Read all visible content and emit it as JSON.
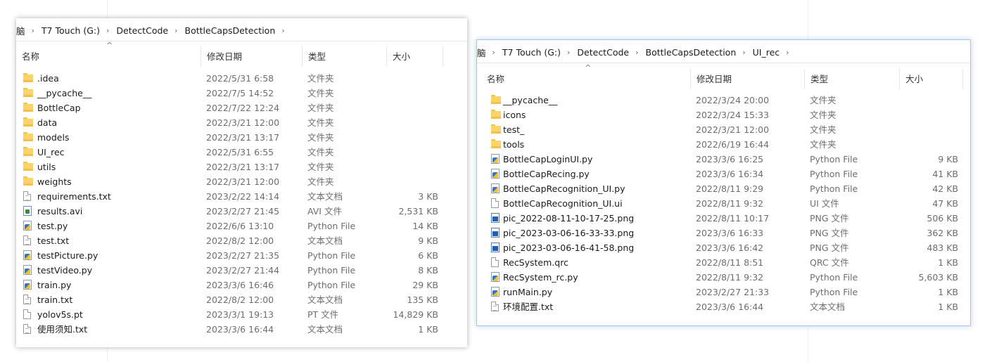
{
  "left": {
    "breadcrumb": [
      "脑",
      "T7 Touch (G:)",
      "DetectCode",
      "BottleCapsDetection"
    ],
    "columns": {
      "name": "名称",
      "date": "修改日期",
      "type": "类型",
      "size": "大小"
    },
    "files": [
      {
        "name": ".idea",
        "date": "2022/5/31 6:58",
        "type": "文件夹",
        "size": "",
        "icon": "folder-icon"
      },
      {
        "name": "__pycache__",
        "date": "2022/7/5 14:52",
        "type": "文件夹",
        "size": "",
        "icon": "folder-icon"
      },
      {
        "name": "BottleCap",
        "date": "2022/7/22 12:24",
        "type": "文件夹",
        "size": "",
        "icon": "folder-icon"
      },
      {
        "name": "data",
        "date": "2022/3/21 12:00",
        "type": "文件夹",
        "size": "",
        "icon": "folder-icon"
      },
      {
        "name": "models",
        "date": "2022/3/21 13:17",
        "type": "文件夹",
        "size": "",
        "icon": "folder-icon"
      },
      {
        "name": "UI_rec",
        "date": "2022/5/31 6:55",
        "type": "文件夹",
        "size": "",
        "icon": "folder-icon"
      },
      {
        "name": "utils",
        "date": "2022/3/21 13:17",
        "type": "文件夹",
        "size": "",
        "icon": "folder-icon"
      },
      {
        "name": "weights",
        "date": "2022/3/21 12:00",
        "type": "文件夹",
        "size": "",
        "icon": "folder-icon"
      },
      {
        "name": "requirements.txt",
        "date": "2023/2/22 14:14",
        "type": "文本文档",
        "size": "3 KB",
        "icon": "text-file-icon"
      },
      {
        "name": "results.avi",
        "date": "2023/2/27 21:45",
        "type": "AVI 文件",
        "size": "2,531 KB",
        "icon": "video-file-icon"
      },
      {
        "name": "test.py",
        "date": "2022/6/6 13:10",
        "type": "Python File",
        "size": "14 KB",
        "icon": "python-file-icon"
      },
      {
        "name": "test.txt",
        "date": "2022/8/2 12:00",
        "type": "文本文档",
        "size": "9 KB",
        "icon": "text-file-icon"
      },
      {
        "name": "testPicture.py",
        "date": "2023/2/27 21:35",
        "type": "Python File",
        "size": "6 KB",
        "icon": "python-file-icon"
      },
      {
        "name": "testVideo.py",
        "date": "2023/2/27 21:44",
        "type": "Python File",
        "size": "8 KB",
        "icon": "python-file-icon"
      },
      {
        "name": "train.py",
        "date": "2023/3/6 16:46",
        "type": "Python File",
        "size": "29 KB",
        "icon": "python-file-icon"
      },
      {
        "name": "train.txt",
        "date": "2022/8/2 12:00",
        "type": "文本文档",
        "size": "135 KB",
        "icon": "text-file-icon"
      },
      {
        "name": "yolov5s.pt",
        "date": "2023/3/1 19:13",
        "type": "PT 文件",
        "size": "14,829 KB",
        "icon": "file-icon"
      },
      {
        "name": "使用须知.txt",
        "date": "2023/3/6 16:44",
        "type": "文本文档",
        "size": "1 KB",
        "icon": "text-file-icon"
      }
    ]
  },
  "right": {
    "breadcrumb": [
      "脑",
      "T7 Touch (G:)",
      "DetectCode",
      "BottleCapsDetection",
      "UI_rec"
    ],
    "columns": {
      "name": "名称",
      "date": "修改日期",
      "type": "类型",
      "size": "大小"
    },
    "files": [
      {
        "name": "__pycache__",
        "date": "2022/3/24 20:00",
        "type": "文件夹",
        "size": "",
        "icon": "folder-icon"
      },
      {
        "name": "icons",
        "date": "2022/3/24 15:33",
        "type": "文件夹",
        "size": "",
        "icon": "folder-icon"
      },
      {
        "name": "test_",
        "date": "2022/3/21 12:00",
        "type": "文件夹",
        "size": "",
        "icon": "folder-icon"
      },
      {
        "name": "tools",
        "date": "2022/6/19 16:44",
        "type": "文件夹",
        "size": "",
        "icon": "folder-icon"
      },
      {
        "name": "BottleCapLoginUI.py",
        "date": "2023/3/6 16:25",
        "type": "Python File",
        "size": "9 KB",
        "icon": "python-file-icon"
      },
      {
        "name": "BottleCapRecing.py",
        "date": "2023/3/6 16:34",
        "type": "Python File",
        "size": "41 KB",
        "icon": "python-file-icon"
      },
      {
        "name": "BottleCapRecognition_UI.py",
        "date": "2022/8/11 9:29",
        "type": "Python File",
        "size": "42 KB",
        "icon": "python-file-icon"
      },
      {
        "name": "BottleCapRecognition_UI.ui",
        "date": "2022/8/11 9:32",
        "type": "UI 文件",
        "size": "47 KB",
        "icon": "file-icon"
      },
      {
        "name": "pic_2022-08-11-10-17-25.png",
        "date": "2022/8/11 10:17",
        "type": "PNG 文件",
        "size": "506 KB",
        "icon": "image-file-icon"
      },
      {
        "name": "pic_2023-03-06-16-33-33.png",
        "date": "2023/3/6 16:33",
        "type": "PNG 文件",
        "size": "362 KB",
        "icon": "image-file-icon"
      },
      {
        "name": "pic_2023-03-06-16-41-58.png",
        "date": "2023/3/6 16:42",
        "type": "PNG 文件",
        "size": "483 KB",
        "icon": "image-file-icon"
      },
      {
        "name": "RecSystem.qrc",
        "date": "2022/8/11 8:51",
        "type": "QRC 文件",
        "size": "1 KB",
        "icon": "file-icon"
      },
      {
        "name": "RecSystem_rc.py",
        "date": "2022/8/11 9:32",
        "type": "Python File",
        "size": "5,603 KB",
        "icon": "python-file-icon"
      },
      {
        "name": "runMain.py",
        "date": "2023/2/27 21:33",
        "type": "Python File",
        "size": "1 KB",
        "icon": "python-file-icon"
      },
      {
        "name": "环境配置.txt",
        "date": "2023/3/6 16:44",
        "type": "文本文档",
        "size": "1 KB",
        "icon": "text-file-icon"
      }
    ]
  }
}
